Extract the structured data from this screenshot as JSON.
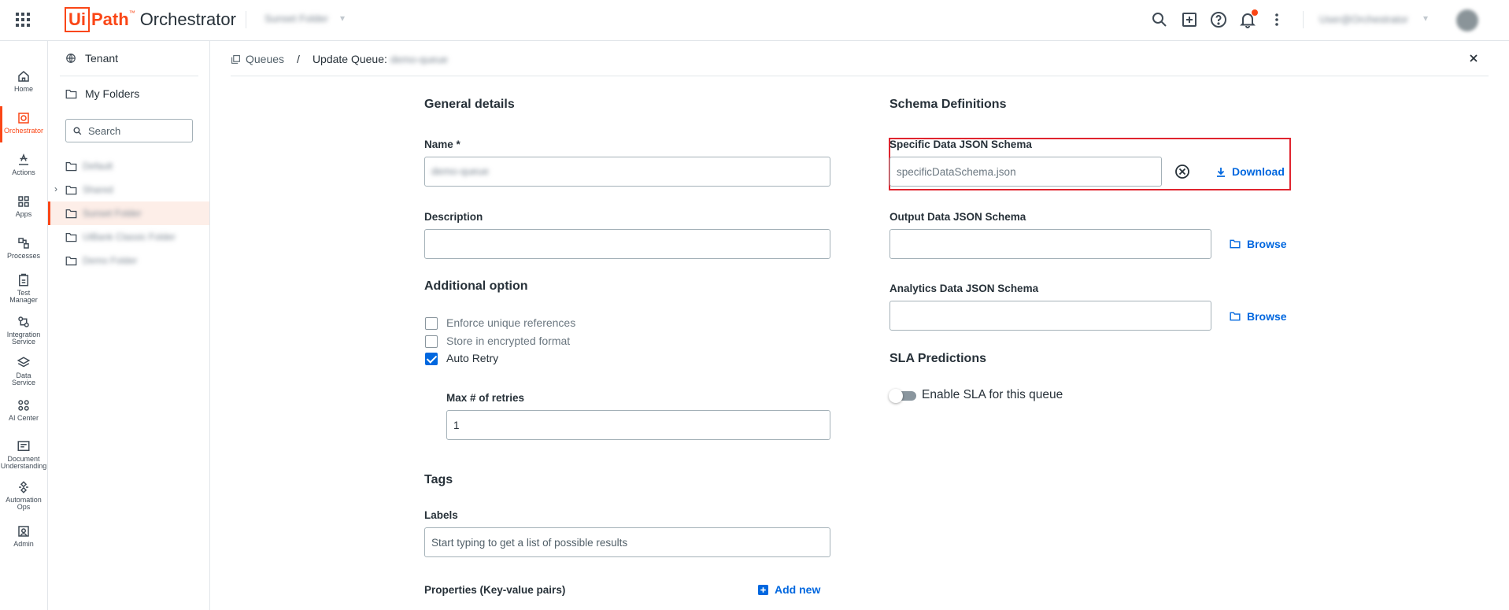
{
  "header": {
    "logo_box": "Ui",
    "logo_path": "Path",
    "logo_tm": "™",
    "product": "Orchestrator",
    "tenant": "Sunset Folder",
    "user": "User@Orchestrator",
    "caret": "▾"
  },
  "rail": {
    "items": [
      {
        "label": "Home"
      },
      {
        "label": "Orchestrator"
      },
      {
        "label": "Actions"
      },
      {
        "label": "Apps"
      },
      {
        "label": "Processes"
      },
      {
        "label": "Test Manager"
      },
      {
        "label": "Integration Service"
      },
      {
        "label": "Data Service"
      },
      {
        "label": "AI Center"
      },
      {
        "label": "Document Understanding"
      },
      {
        "label": "Automation Ops"
      },
      {
        "label": "Admin"
      }
    ]
  },
  "tree": {
    "tenant_label": "Tenant",
    "my_folders_label": "My Folders",
    "search_placeholder": "Search",
    "folders": [
      {
        "label": "Default"
      },
      {
        "label": "Shared"
      },
      {
        "label": "Sunset Folder"
      },
      {
        "label": "UiBank Classic Folder"
      },
      {
        "label": "Demo Folder"
      }
    ]
  },
  "breadcrumb": {
    "queues": "Queues",
    "separator": "/",
    "current": "Update Queue:",
    "queue_name": "demo-queue"
  },
  "general": {
    "title": "General details",
    "name_label": "Name *",
    "name_value": "demo-queue",
    "description_label": "Description",
    "description_value": ""
  },
  "additional": {
    "title": "Additional option",
    "options": [
      {
        "label": "Enforce unique references",
        "checked": false
      },
      {
        "label": "Store in encrypted format",
        "checked": false
      },
      {
        "label": "Auto Retry",
        "checked": true
      }
    ],
    "max_retries_label": "Max # of retries",
    "max_retries_value": "1"
  },
  "tags": {
    "title": "Tags",
    "labels_label": "Labels",
    "labels_placeholder": "Start typing to get a list of possible results",
    "properties_label": "Properties (Key-value pairs)",
    "add_new": "Add new"
  },
  "schema": {
    "title": "Schema Definitions",
    "specific_label": "Specific Data JSON Schema",
    "specific_value": "specificDataSchema.json",
    "download": "Download",
    "output_label": "Output Data JSON Schema",
    "output_value": "",
    "analytics_label": "Analytics Data JSON Schema",
    "analytics_value": "",
    "browse": "Browse"
  },
  "sla": {
    "title": "SLA Predictions",
    "toggle_label": "Enable SLA for this queue",
    "enabled": false
  },
  "colors": {
    "brand": "#fa4616",
    "link": "#0067df",
    "highlight": "#e0252f"
  }
}
